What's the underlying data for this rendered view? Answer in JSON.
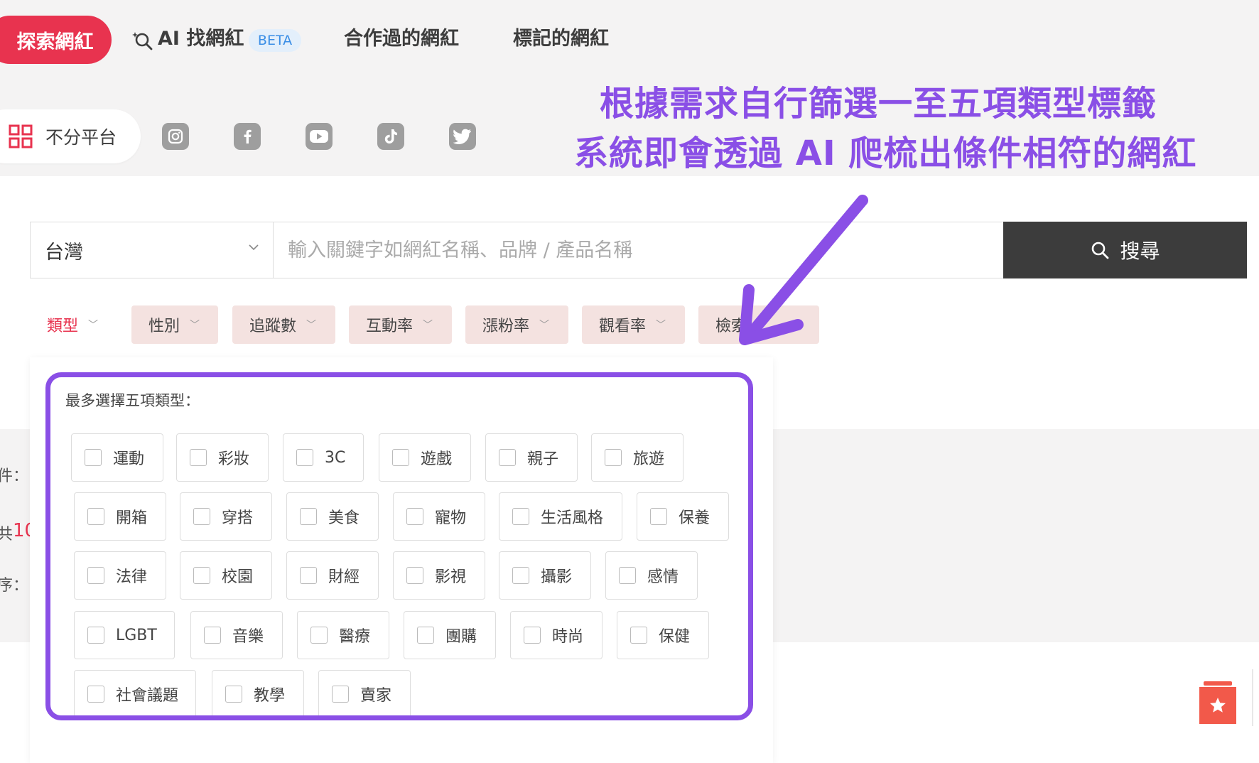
{
  "nav": {
    "explore": "探索網紅",
    "ai_find": "AI 找網紅",
    "beta": "BETA",
    "cooperated": "合作過的網紅",
    "marked": "標記的網紅"
  },
  "platform": {
    "all_label": "不分平台",
    "icons": [
      "instagram-icon",
      "facebook-icon",
      "youtube-icon",
      "tiktok-icon",
      "twitter-icon"
    ]
  },
  "annotation": {
    "line1": "根據需求自行篩選一至五項類型標籤",
    "line2": "系統即會透過 AI 爬梳出條件相符的網紅",
    "color": "#8a4fe6"
  },
  "search": {
    "region": "台灣",
    "placeholder": "輸入關鍵字如網紅名稱、品牌 / 產品名稱",
    "button": "搜尋"
  },
  "filters": [
    "類型",
    "性別",
    "追蹤數",
    "互動率",
    "漲粉率",
    "觀看率",
    "檢索"
  ],
  "dropdown": {
    "title": "最多選擇五項類型：",
    "categories": [
      "運動",
      "彩妝",
      "3C",
      "遊戲",
      "親子",
      "旅遊",
      "開箱",
      "穿搭",
      "美食",
      "寵物",
      "生活風格",
      "保養",
      "法律",
      "校園",
      "財經",
      "影視",
      "攝影",
      "感情",
      "LGBT",
      "音樂",
      "醫療",
      "團購",
      "時尚",
      "保健",
      "社會議題",
      "教學",
      "賣家"
    ]
  },
  "left_cut": {
    "a": "件：",
    "b": "共",
    "b_num": "10",
    "c": "序："
  },
  "colors": {
    "brand": "#e8334f",
    "accent_purple": "#8a4fe6",
    "search_button": "#3c3c3c",
    "chip_bg": "#f4e2e0"
  }
}
